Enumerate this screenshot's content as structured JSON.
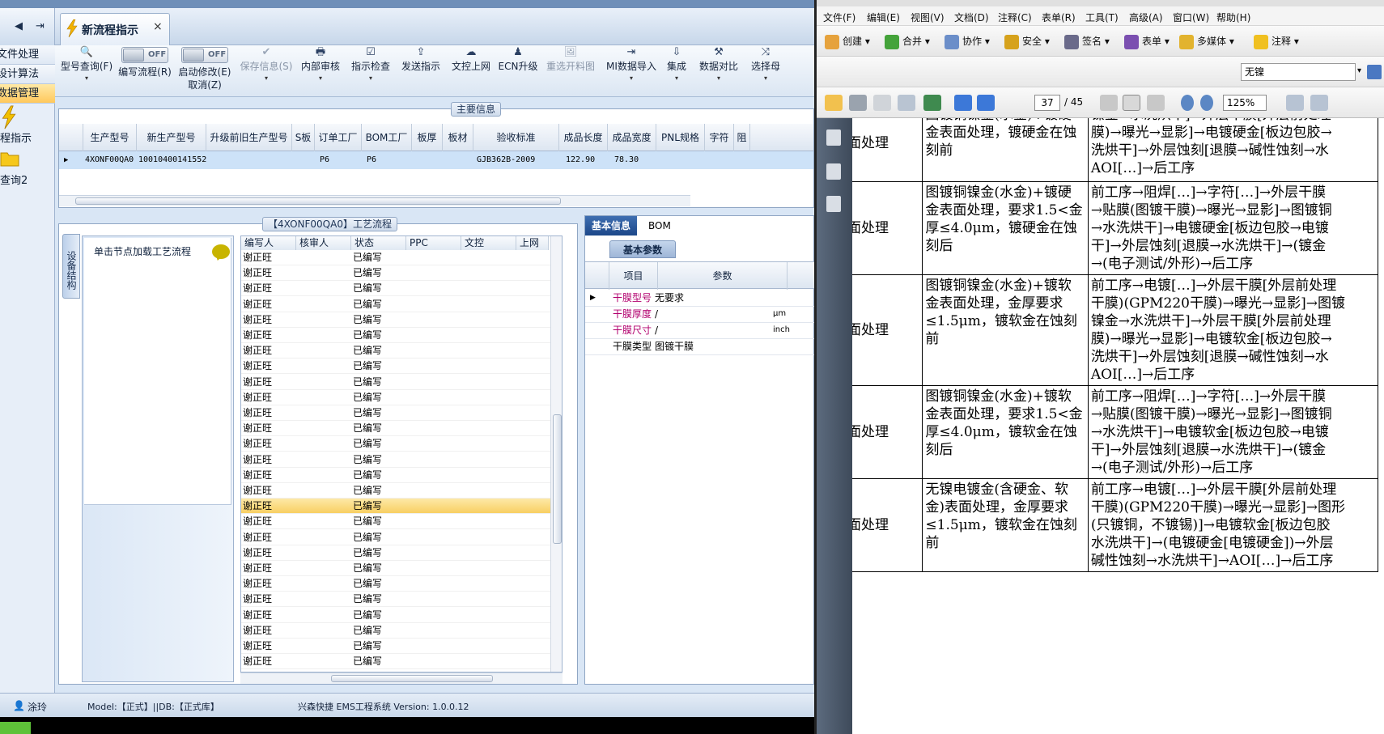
{
  "ems": {
    "nav_back": "◀",
    "nav_forward": "⇥",
    "tab_title": "新流程指示",
    "tab_close": "×",
    "sidebar": [
      "文件处理",
      "设计算法",
      "数据管理"
    ],
    "sidebar_big": [
      "程指示",
      "查询2"
    ],
    "toolbar": [
      {
        "label": "型号查询(F)",
        "icon": "🔍",
        "dd": "▾"
      },
      {
        "label": "编写流程(R)",
        "toggle": "OFF"
      },
      {
        "label": "启动修改(E)",
        "label2": "取消(Z)",
        "toggle": "OFF"
      },
      {
        "label": "保存信息(S)",
        "icon": "✔",
        "dd": "▾",
        "disabled": true
      },
      {
        "label": "内部审核",
        "icon": "🖶",
        "dd": "▾"
      },
      {
        "label": "指示检查",
        "icon": "☑",
        "dd": "▾"
      },
      {
        "label": "发送指示",
        "icon": "⇪"
      },
      {
        "label": "文控上网",
        "icon": "☁"
      },
      {
        "label": "ECN升级",
        "icon": "♟"
      },
      {
        "label": "重选开料图",
        "icon": "🖼",
        "disabled": true
      },
      {
        "label": "MI数据导入",
        "icon": "⇥",
        "dd": "▾"
      },
      {
        "label": "集成",
        "icon": "⇩",
        "dd": "▾"
      },
      {
        "label": "数据对比",
        "icon": "⚒",
        "dd": "▾"
      },
      {
        "label": "选择母",
        "icon": "⤨",
        "dd": "▾"
      }
    ],
    "main_info_title": "主要信息",
    "main_columns": [
      "生产型号",
      "新生产型号",
      "升级前旧生产型号",
      "S板",
      "订单工厂",
      "BOM工厂",
      "板厚",
      "板材",
      "验收标准",
      "成品长度",
      "成品宽度",
      "PNL规格",
      "字符",
      "阻"
    ],
    "main_row": [
      "4XONF00QA0",
      "10010400141552",
      "",
      "",
      "P6",
      "P6",
      "",
      "",
      "GJB362B-2009",
      "122.90",
      "78.30",
      "",
      "",
      ""
    ],
    "flow_title": "【4XONF00QA0】工艺流程",
    "side_vtab": "设备结构",
    "node_hint": "单击节点加载工艺流程",
    "flow_columns": [
      "编写人",
      "核审人",
      "状态",
      "PPC",
      "文控",
      "上网"
    ],
    "flow_rows": [
      [
        "谢正旺",
        "",
        "已编写"
      ],
      [
        "谢正旺",
        "",
        "已编写"
      ],
      [
        "谢正旺",
        "",
        "已编写"
      ],
      [
        "谢正旺",
        "",
        "已编写"
      ],
      [
        "谢正旺",
        "",
        "已编写"
      ],
      [
        "谢正旺",
        "",
        "已编写"
      ],
      [
        "谢正旺",
        "",
        "已编写"
      ],
      [
        "谢正旺",
        "",
        "已编写"
      ],
      [
        "谢正旺",
        "",
        "已编写"
      ],
      [
        "谢正旺",
        "",
        "已编写"
      ],
      [
        "谢正旺",
        "",
        "已编写"
      ],
      [
        "谢正旺",
        "",
        "已编写"
      ],
      [
        "谢正旺",
        "",
        "已编写"
      ],
      [
        "谢正旺",
        "",
        "已编写"
      ],
      [
        "谢正旺",
        "",
        "已编写"
      ],
      [
        "谢正旺",
        "",
        "已编写"
      ],
      [
        "谢正旺",
        "",
        "已编写"
      ],
      [
        "谢正旺",
        "",
        "已编写"
      ],
      [
        "谢正旺",
        "",
        "已编写"
      ],
      [
        "谢正旺",
        "",
        "已编写"
      ],
      [
        "谢正旺",
        "",
        "已编写"
      ],
      [
        "谢正旺",
        "",
        "已编写"
      ],
      [
        "谢正旺",
        "",
        "已编写"
      ],
      [
        "谢正旺",
        "",
        "已编写"
      ],
      [
        "谢正旺",
        "",
        "已编写"
      ],
      [
        "谢正旺",
        "",
        "已编写"
      ],
      [
        "谢正旺",
        "",
        "已编写"
      ]
    ],
    "selected_row_index": 16,
    "info_tabs": [
      "基本信息",
      "BOM"
    ],
    "param_subtab": "基本参数",
    "param_columns": [
      "项目",
      "参数"
    ],
    "params": [
      {
        "item": "干膜型号",
        "value": "无要求",
        "unit": ""
      },
      {
        "item": "干膜厚度",
        "value": "/",
        "unit": "μm"
      },
      {
        "item": "干膜尺寸",
        "value": "/",
        "unit": "inch"
      },
      {
        "item": "干膜类型",
        "value": "图镀干膜",
        "unit": ""
      }
    ],
    "status_user": "涂玲",
    "status_model": "Model:【正式】||DB:【正式库】",
    "status_app": "兴森快捷 EMS工程系统 Version: 1.0.0.12"
  },
  "pdf": {
    "menus": [
      "文件(F)",
      "编辑(E)",
      "视图(V)",
      "文档(D)",
      "注释(C)",
      "表单(R)",
      "工具(T)",
      "高级(A)",
      "窗口(W)",
      "帮助(H)"
    ],
    "tools": [
      "创建",
      "合并",
      "协作",
      "安全",
      "签名",
      "表单",
      "多媒体",
      "注释"
    ],
    "search": "无镍",
    "page_current": "37",
    "page_total": "/ 45",
    "zoom": "125%",
    "rows": [
      {
        "c1": "面处理",
        "c2": "图镀铜镍金(水金)+镀硬金表面处理，镀硬金在蚀刻前",
        "c3": [
          "镍金→水洗烘干]→外层干膜[外层前处理",
          "膜)→曝光→显影]→电镀硬金[板边包胶→",
          "洗烘干]→外层蚀刻[退膜→碱性蚀刻→水",
          "AOI[…]→后工序"
        ]
      },
      {
        "c1": "面处理",
        "c2": "图镀铜镍金(水金)+镀硬金表面处理，要求1.5<金厚≤4.0μm，镀硬金在蚀刻后",
        "c3": [
          "前工序→阻焊[…]→字符[…]→外层干膜",
          "→贴膜(图镀干膜)→曝光→显影]→图镀铜",
          "→水洗烘干]→电镀硬金[板边包胶→电镀",
          "干]→外层蚀刻[退膜→水洗烘干]→(镀金",
          "→(电子测试/外形)→后工序"
        ]
      },
      {
        "c1": "面处理",
        "c2": "图镀铜镍金(水金)+镀软金表面处理，金厚要求≤1.5μm，镀软金在蚀刻前",
        "c3": [
          "前工序→电镀[…]→外层干膜[外层前处理",
          "干膜)(GPM220干膜)→曝光→显影]→图镀",
          "镍金→水洗烘干]→外层干膜[外层前处理",
          "膜)→曝光→显影]→电镀软金[板边包胶→",
          "洗烘干]→外层蚀刻[退膜→碱性蚀刻→水",
          "AOI[…]→后工序"
        ]
      },
      {
        "c1": "面处理",
        "c2": "图镀铜镍金(水金)+镀软金表面处理，要求1.5<金厚≤4.0μm，镀软金在蚀刻后",
        "c3": [
          "前工序→阻焊[…]→字符[…]→外层干膜",
          "→贴膜(图镀干膜)→曝光→显影]→图镀铜",
          "→水洗烘干]→电镀软金[板边包胶→电镀",
          "干]→外层蚀刻[退膜→水洗烘干]→(镀金",
          "→(电子测试/外形)→后工序"
        ]
      },
      {
        "c1": "面处理",
        "c2": "无镍电镀金(含硬金、软金)表面处理，金厚要求≤1.5μm，镀软金在蚀刻前",
        "c3": [
          "前工序→电镀[…]→外层干膜[外层前处理",
          "干膜)(GPM220干膜)→曝光→显影]→图形",
          "(只镀铜，不镀锡)]→电镀软金[板边包胶",
          "水洗烘干]→(电镀硬金[电镀硬金])→外层",
          "碱性蚀刻→水洗烘干]→AOI[…]→后工序"
        ]
      }
    ]
  }
}
